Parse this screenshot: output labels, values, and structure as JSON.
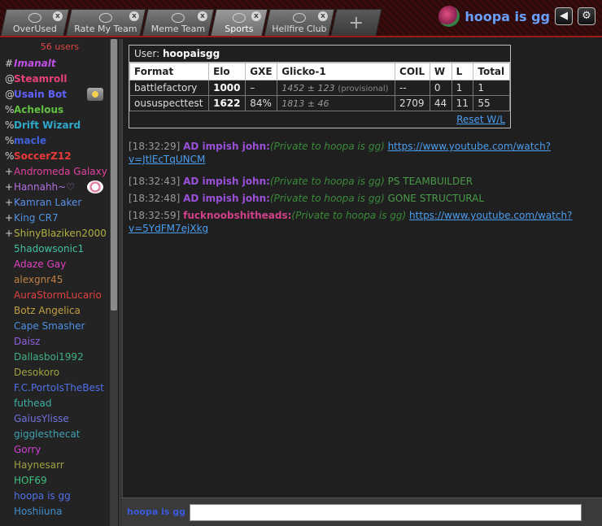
{
  "header": {
    "tabs": [
      {
        "label": "OverUsed",
        "active": false
      },
      {
        "label": "Rate My Team",
        "active": false
      },
      {
        "label": "Meme Team",
        "active": false
      },
      {
        "label": "Sports",
        "active": true
      },
      {
        "label": "Hellfire Club",
        "active": false
      }
    ],
    "add_tab_label": "+",
    "username": "hoopa is gg",
    "close_glyph": "x",
    "sound_icon": "speaker-icon",
    "settings_icon": "gear-icon"
  },
  "userlist": {
    "count": "56 users",
    "users": [
      {
        "rank": "#",
        "name": "Imanalt",
        "color": "#c050e8",
        "bold": true,
        "italic": true
      },
      {
        "rank": "@",
        "name": "Steamroll",
        "color": "#e8407a",
        "bold": true,
        "italic": false
      },
      {
        "rank": "@",
        "name": "Usain Bot",
        "color": "#6060ff",
        "bold": true,
        "italic": false
      },
      {
        "rank": "%",
        "name": "Achelous",
        "color": "#60c040",
        "bold": true,
        "italic": false
      },
      {
        "rank": "%",
        "name": "Drift Wizard",
        "color": "#30a8c8",
        "bold": true,
        "italic": false
      },
      {
        "rank": "%",
        "name": "macle",
        "color": "#4060e0",
        "bold": true,
        "italic": false
      },
      {
        "rank": "%",
        "name": "SoccerZ12",
        "color": "#e83a3a",
        "bold": true,
        "italic": false
      },
      {
        "rank": "+",
        "name": "Andromeda Galaxy",
        "color": "#e040a0",
        "bold": false,
        "italic": false
      },
      {
        "rank": "+",
        "name": "Hannahh~♡",
        "color": "#b070e0",
        "bold": false,
        "italic": false
      },
      {
        "rank": "+",
        "name": "Kamran Laker",
        "color": "#5a90e8",
        "bold": false,
        "italic": false
      },
      {
        "rank": "+",
        "name": "King CR7",
        "color": "#5090e0",
        "bold": false,
        "italic": false
      },
      {
        "rank": "+",
        "name": "ShinyBlaziken2000",
        "color": "#b0b040",
        "bold": false,
        "italic": false
      },
      {
        "rank": "",
        "name": "5hadowsonic1",
        "color": "#40c0a0",
        "bold": false,
        "italic": false
      },
      {
        "rank": "",
        "name": "Adaze Gay",
        "color": "#e040c0",
        "bold": false,
        "italic": false
      },
      {
        "rank": "",
        "name": "alexgnr45",
        "color": "#c08040",
        "bold": false,
        "italic": false
      },
      {
        "rank": "",
        "name": "AuraStormLucario",
        "color": "#e04040",
        "bold": false,
        "italic": false
      },
      {
        "rank": "",
        "name": "Botz Angelica",
        "color": "#c0a040",
        "bold": false,
        "italic": false
      },
      {
        "rank": "",
        "name": "Cape Smasher",
        "color": "#4a90e0",
        "bold": false,
        "italic": false
      },
      {
        "rank": "",
        "name": "Daisz",
        "color": "#9060e0",
        "bold": false,
        "italic": false
      },
      {
        "rank": "",
        "name": "Dallasboi1992",
        "color": "#40b080",
        "bold": false,
        "italic": false
      },
      {
        "rank": "",
        "name": "Desokoro",
        "color": "#a0a040",
        "bold": false,
        "italic": false
      },
      {
        "rank": "",
        "name": "F.C.PortoIsTheBest",
        "color": "#5070e8",
        "bold": false,
        "italic": false
      },
      {
        "rank": "",
        "name": "futhead",
        "color": "#40b0a0",
        "bold": false,
        "italic": false
      },
      {
        "rank": "",
        "name": "GaiusYlisse",
        "color": "#7070e0",
        "bold": false,
        "italic": false
      },
      {
        "rank": "",
        "name": "gigglesthecat",
        "color": "#40a0b0",
        "bold": false,
        "italic": false
      },
      {
        "rank": "",
        "name": "Gorry",
        "color": "#d040d0",
        "bold": false,
        "italic": false
      },
      {
        "rank": "",
        "name": "Haynesarr",
        "color": "#a0a040",
        "bold": false,
        "italic": false
      },
      {
        "rank": "",
        "name": "HOF69",
        "color": "#40c080",
        "bold": false,
        "italic": false
      },
      {
        "rank": "",
        "name": "hoopa is gg",
        "color": "#5070e8",
        "bold": false,
        "italic": false
      },
      {
        "rank": "",
        "name": "Hoshiiuna",
        "color": "#4090d0",
        "bold": false,
        "italic": false
      }
    ]
  },
  "stats": {
    "title_prefix": "User:",
    "title_user": "hoopaisgg",
    "columns": [
      "Format",
      "Elo",
      "GXE",
      "Glicko-1",
      "COIL",
      "W",
      "L",
      "Total"
    ],
    "rows": [
      {
        "format": "battlefactory",
        "elo": "1000",
        "gxe": "–",
        "glicko": "1452 ± 123",
        "provisional": "(provisional)",
        "coil": "",
        "w": "0",
        "l": "1",
        "total": "1"
      },
      {
        "format": "oususpecttest",
        "elo": "1622",
        "gxe": "84%",
        "glicko": "1813 ± 46",
        "provisional": "",
        "coil": "2709",
        "w": "44",
        "l": "11",
        "total": "55"
      }
    ],
    "coil_empty": "--",
    "reset_label": "Reset W/L"
  },
  "chat": {
    "messages": [
      {
        "time": "[18:32:29]",
        "speaker": "AD impish john:",
        "speaker_color": "#9a50d8",
        "pm": "(Private to hoopa is gg)",
        "text": "",
        "link": "https://www.youtube.com/watch?v=JtlEcTqUNCM"
      },
      {
        "time": "[18:32:43]",
        "speaker": "AD impish john:",
        "speaker_color": "#9a50d8",
        "pm": "(Private to hoopa is gg)",
        "text": "PS TEAMBUILDER",
        "link": ""
      },
      {
        "time": "[18:32:48]",
        "speaker": "AD impish john:",
        "speaker_color": "#9a50d8",
        "pm": "(Private to hoopa is gg)",
        "text": "GONE STRUCTURAL",
        "link": ""
      },
      {
        "time": "[18:32:59]",
        "speaker": "fucknoobshitheads:",
        "speaker_color": "#d0408a",
        "pm": "(Private to hoopa is gg)",
        "text": "",
        "link": "https://www.youtube.com/watch?v=5YdFM7ejXkg"
      }
    ]
  },
  "input": {
    "username": "hoopa is gg",
    "value": ""
  }
}
